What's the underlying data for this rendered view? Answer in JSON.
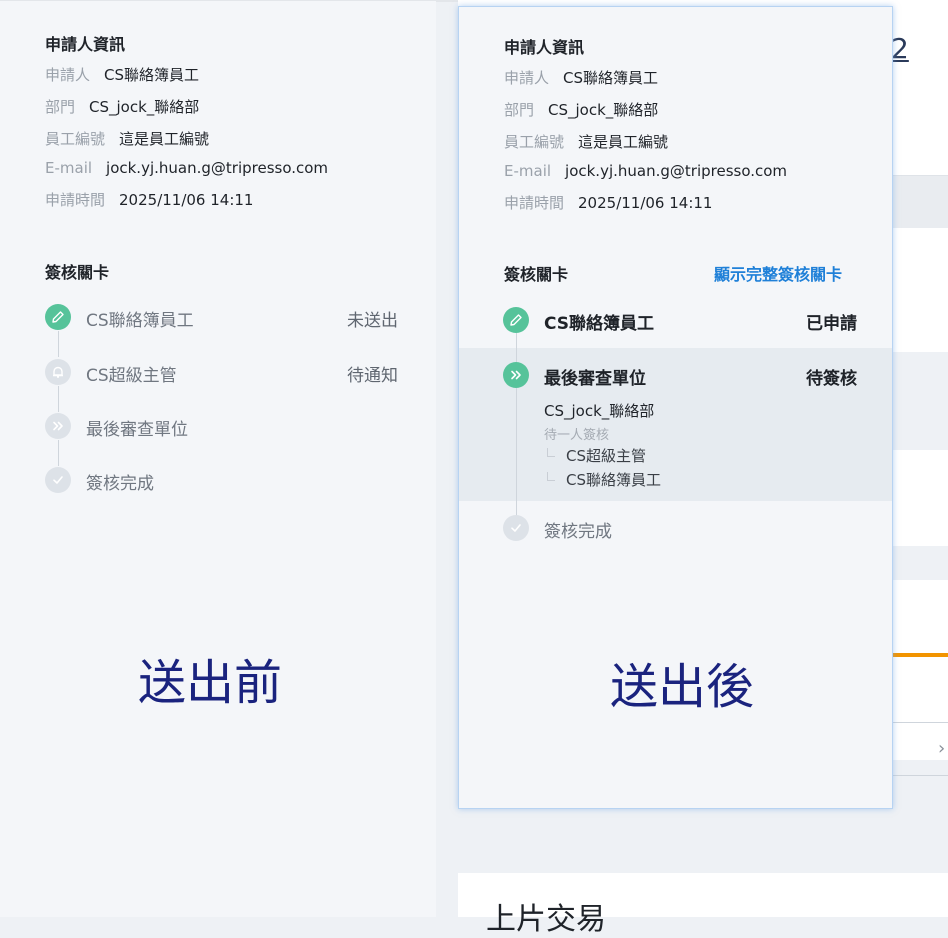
{
  "before": {
    "applicant_section_title": "申請人資訊",
    "fields": [
      {
        "label": "申請人",
        "value": "CS聯絡簿員工"
      },
      {
        "label": "部門",
        "value": "CS_jock_聯絡部"
      },
      {
        "label": "員工編號",
        "value": "這是員工編號"
      },
      {
        "label": "E-mail",
        "value": "jock.yj.huan.g@tripresso.com"
      },
      {
        "label": "申請時間",
        "value": "2025/11/06 14:11"
      }
    ],
    "approval_section_title": "簽核關卡",
    "steps": [
      {
        "label": "CS聯絡簿員工",
        "status": "未送出",
        "icon": "pencil-icon"
      },
      {
        "label": "CS超級主管",
        "status": "待通知",
        "icon": "bell-icon"
      },
      {
        "label": "最後審查單位",
        "status": "",
        "icon": "double-chevron-icon"
      },
      {
        "label": "簽核完成",
        "status": "",
        "icon": "check-icon"
      }
    ],
    "caption": "送出前"
  },
  "after": {
    "applicant_section_title": "申請人資訊",
    "fields": [
      {
        "label": "申請人",
        "value": "CS聯絡簿員工"
      },
      {
        "label": "部門",
        "value": "CS_jock_聯絡部"
      },
      {
        "label": "員工編號",
        "value": "這是員工編號"
      },
      {
        "label": "E-mail",
        "value": "jock.yj.huan.g@tripresso.com"
      },
      {
        "label": "申請時間",
        "value": "2025/11/06 14:11"
      }
    ],
    "approval_section_title": "簽核關卡",
    "show_full_link": "顯示完整簽核關卡",
    "steps": [
      {
        "label": "CS聯絡簿員工",
        "status": "已申請",
        "icon": "pencil-icon"
      },
      {
        "label": "最後審查單位",
        "status": "待簽核",
        "icon": "double-chevron-icon",
        "department": "CS_jock_聯絡部",
        "hint": "待一人簽核",
        "members": [
          "CS超級主管",
          "CS聯絡簿員工"
        ]
      },
      {
        "label": "簽核完成",
        "status": "",
        "icon": "check-icon"
      }
    ],
    "caption": "送出後"
  },
  "background": {
    "partial_number": "2",
    "partial_heading": "上片交易"
  },
  "colors": {
    "accent_green": "#56c39a",
    "link_blue": "#1f80d8",
    "caption_navy": "#1a237e",
    "orange_bar": "#f29400"
  }
}
